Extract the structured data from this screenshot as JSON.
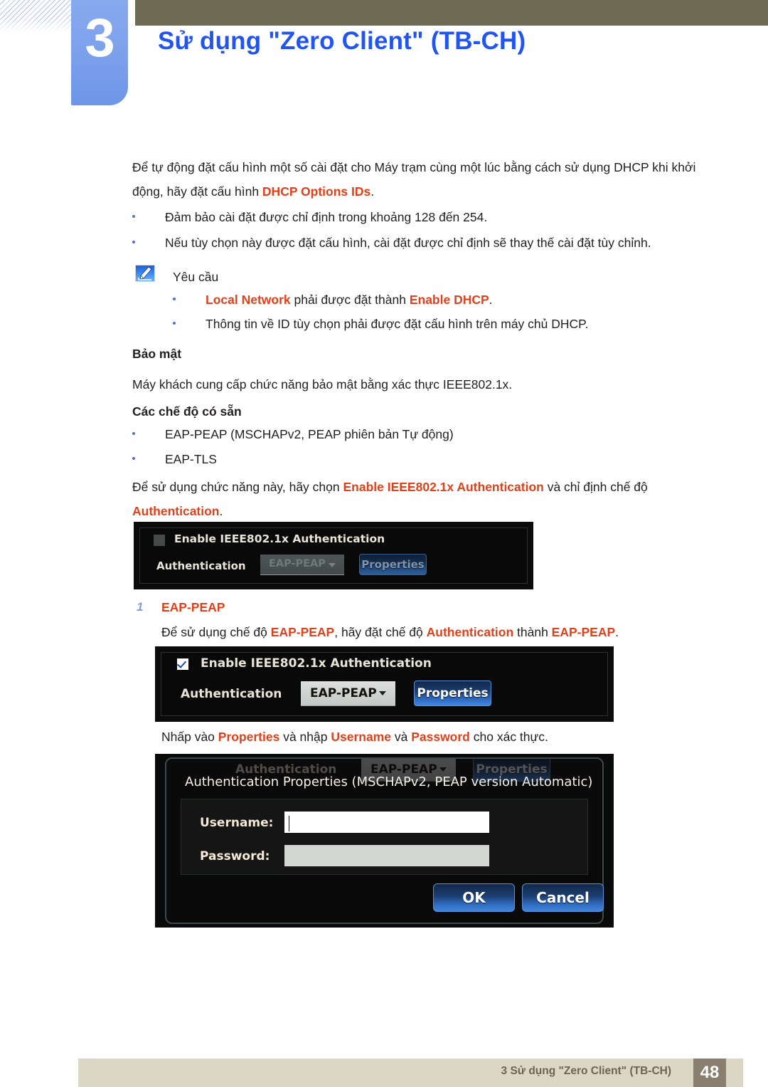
{
  "header": {
    "chapter_number": "3",
    "chapter_title": "Sử dụng \"Zero Client\" (TB-CH)",
    "accent_blue": "#2255ee",
    "tab_blue": "#7ba0ec",
    "olive": "#6e6a54"
  },
  "intro": {
    "line1_before": "Để tự động đặt cấu hình một số cài đặt cho Máy trạm cùng một lúc bằng cách sử dụng DHCP khi khởi",
    "line2_before": "động, hãy đặt cấu hình ",
    "line2_bold": "DHCP Options IDs",
    "line2_after": "."
  },
  "intro_bullets": [
    "Đảm bảo cài đặt được chỉ định trong khoảng 128 đến 254.",
    "Nếu tùy chọn này được đặt cấu hình, cài đặt được chỉ định sẽ thay thế cài đặt tùy chỉnh."
  ],
  "note": {
    "icon": "note-pencil-icon",
    "title": "Yêu cầu",
    "bullet1_bold1": "Local Network",
    "bullet1_mid": " phải được đặt thành ",
    "bullet1_bold2": "Enable DHCP",
    "bullet1_end": ".",
    "bullet2": "Thông tin về ID tùy chọn phải được đặt cấu hình trên máy chủ DHCP."
  },
  "security": {
    "heading": "Bảo mật",
    "paragraph": "Máy khách cung cấp chức năng bảo mật bằng xác thực IEEE802.1x.",
    "modes_heading": "Các chế độ có sẵn",
    "modes": [
      "EAP-PEAP (MSCHAPv2, PEAP phiên bản Tự động)",
      "EAP-TLS"
    ],
    "usage_before": "Để sử dụng chức năng này, hãy chọn ",
    "usage_bold1": "Enable IEEE802.1x Authentication",
    "usage_mid": " và chỉ định chế độ",
    "usage_bold2": "Authentication",
    "usage_end": "."
  },
  "shot1": {
    "checkbox_state": "unchecked",
    "checkbox_label": "Enable IEEE802.1x Authentication",
    "auth_label": "Authentication",
    "combo_value": "EAP-PEAP",
    "properties_button": "Properties"
  },
  "step1": {
    "number": "1",
    "title": "EAP-PEAP",
    "desc_before": "Để sử dụng chế độ ",
    "desc_bold1": "EAP-PEAP",
    "desc_mid1": ", hãy đặt chế độ ",
    "desc_bold2": "Authentication",
    "desc_mid2": " thành ",
    "desc_bold3": "EAP-PEAP",
    "desc_end": "."
  },
  "shot2": {
    "checkbox_state": "checked",
    "checkbox_label": "Enable IEEE802.1x Authentication",
    "auth_label": "Authentication",
    "combo_value": "EAP-PEAP",
    "properties_button": "Properties"
  },
  "properties_line": {
    "before": "Nhấp vào ",
    "bold1": "Properties",
    "mid1": " và nhập ",
    "bold2": "Username",
    "mid2": " và ",
    "bold3": "Password",
    "end": " cho xác thực."
  },
  "shot3": {
    "ghost_auth_label": "Authentication",
    "ghost_combo_value": "EAP-PEAP",
    "ghost_properties_button": "Properties",
    "dialog_title": "Authentication Properties (MSCHAPv2, PEAP version Automatic)",
    "username_label": "Username:",
    "username_value": "",
    "password_label": "Password:",
    "password_value": "",
    "ok_button": "OK",
    "cancel_button": "Cancel"
  },
  "footer": {
    "text": "3 Sử dụng \"Zero Client\" (TB-CH)",
    "page_number": "48",
    "bar_color": "#dcd6c4",
    "page_box_color": "#8a7e6e"
  }
}
